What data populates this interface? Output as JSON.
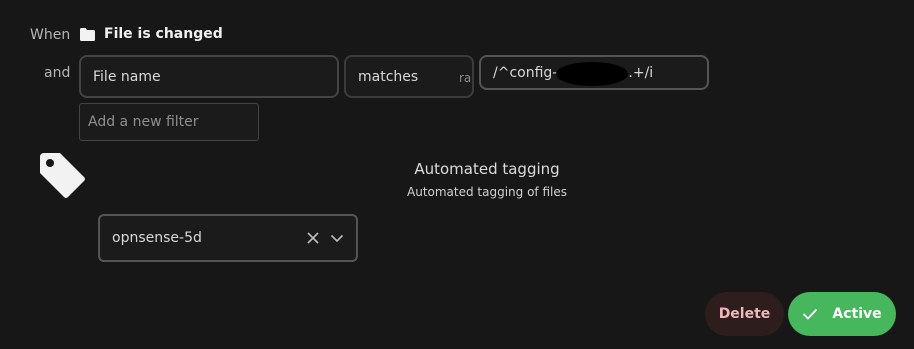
{
  "trigger": {
    "when_label": "When",
    "folder_icon": "folder-icon",
    "event_name": "File is changed"
  },
  "filter": {
    "and_label": "and",
    "field_name": "File name",
    "operator": "matches",
    "operator_overflow": "ra",
    "value_prefix": "/^config-",
    "value_suffix": "-.+/i",
    "add_placeholder": "Add a new filter"
  },
  "action": {
    "icon": "tag-icon",
    "title": "Automated tagging",
    "subtitle": "Automated tagging of files",
    "tag_value": "opnsense-5d"
  },
  "footer": {
    "delete_label": "Delete",
    "active_label": "Active"
  },
  "colors": {
    "active": "#46b75c",
    "delete_bg": "#2e1d1d",
    "delete_text": "#f0b7b7"
  }
}
